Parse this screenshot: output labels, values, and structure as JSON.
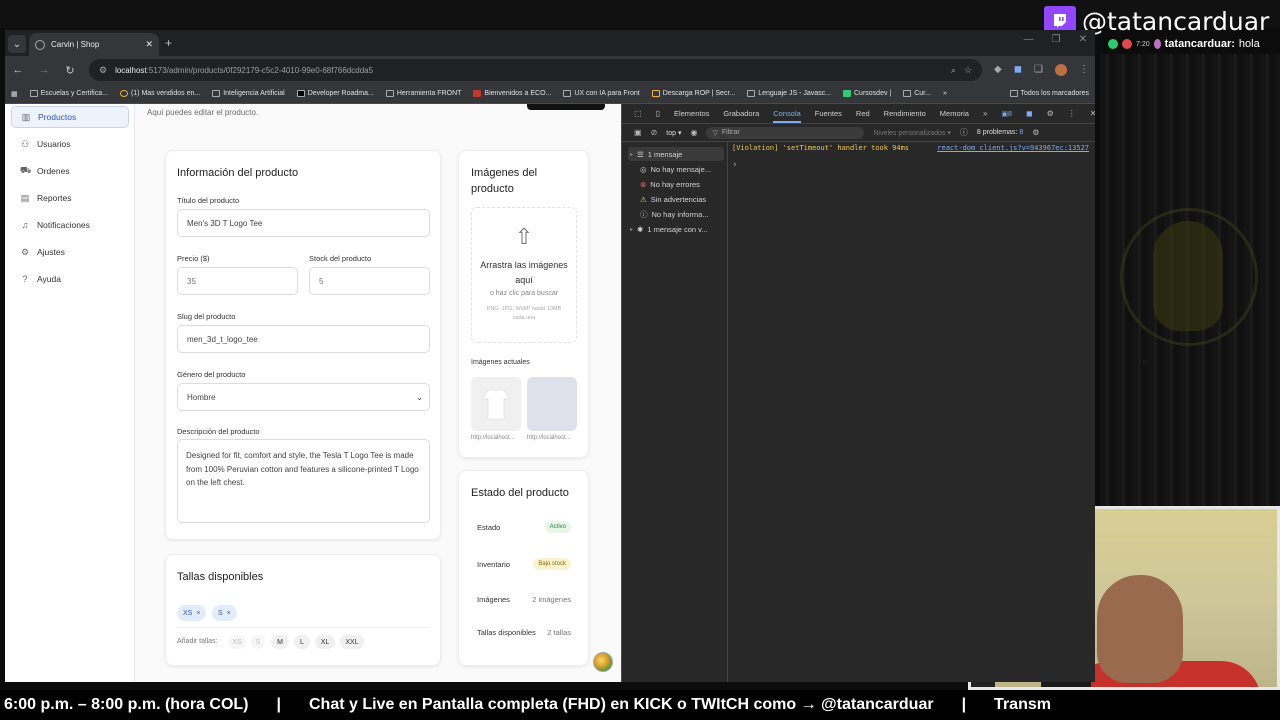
{
  "stream": {
    "twitch_handle": "@tatancarduar",
    "chat_user": "tatancarduar:",
    "chat_msg": "hola",
    "chat_time": "7:20",
    "ticker": [
      "6:00 p.m. – 8:00 p.m. (hora COL)",
      "|",
      "Chat y Live en Pantalla completa (FHD)  en KICK  o TWItCH como → @tatancarduar",
      "|",
      "Transm"
    ]
  },
  "browser": {
    "tab_title": "Carvin | Shop",
    "url_host": "localhost",
    "url_path": ":5173/admin/products/0f292179-c5c2-4010-99e0-68f766dcdda5",
    "bookmarks": [
      "Escuelas y Certifica...",
      "(1) Mas vendidos en...",
      "Inteligencia Artificial",
      "Developer Roadma...",
      "Herramienta FRONT",
      "Bienvenidos a ECO...",
      "UX con IA para Front",
      "Descarga ROP | Secr...",
      "Lenguaje JS - Javasc...",
      "Cursosdev |",
      "Cur..."
    ],
    "bookmarks_all": "Todos los marcadores"
  },
  "sidebar": {
    "items": [
      {
        "label": "Productos",
        "icon": "chart-icon"
      },
      {
        "label": "Usuarios",
        "icon": "users-icon"
      },
      {
        "label": "Ordenes",
        "icon": "cart-icon"
      },
      {
        "label": "Reportes",
        "icon": "document-icon"
      },
      {
        "label": "Notificaciones",
        "icon": "bell-icon"
      },
      {
        "label": "Ajustes",
        "icon": "gear-icon"
      },
      {
        "label": "Ayuda",
        "icon": "help-icon"
      }
    ]
  },
  "page": {
    "subtitle": "Aquí puedes editar el producto."
  },
  "product_info": {
    "title": "Información del producto",
    "title_label": "Título del producto",
    "title_value": "Men's 3D T Logo Tee",
    "price_label": "Precio ($)",
    "price_value": "35",
    "stock_label": "Stock del producto",
    "stock_value": "5",
    "slug_label": "Slug del producto",
    "slug_value": "men_3d_t_logo_tee",
    "gender_label": "Género del producto",
    "gender_value": "Hombre",
    "desc_label": "Descripción del producto",
    "desc_value": "Designed for fit, comfort and style, the Tesla T Logo Tee is made from 100% Peruvian cotton and features a silicone-printed T Logo on the left chest."
  },
  "images": {
    "title": "Imágenes del producto",
    "drop_main": "Arrastra las imágenes aquí",
    "drop_sub": "o haz clic para buscar",
    "drop_hint": "PNG, JPG, WebP hasta 10MB cada una",
    "current_label": "Imágenes actuales",
    "thumbs": [
      "http://localhost...",
      "http://localhost..."
    ]
  },
  "status": {
    "title": "Estado del producto",
    "rows": [
      {
        "label": "Estado",
        "value": "Activo"
      },
      {
        "label": "Inventario",
        "value": "Bajo stock"
      },
      {
        "label": "Imágenes",
        "value": "2 imágenes"
      },
      {
        "label": "Tallas disponibles",
        "value": "2 tallas"
      }
    ]
  },
  "sizes": {
    "title": "Tallas disponibles",
    "selected": [
      "XS",
      "S"
    ],
    "add_label": "Añadir tallas:",
    "options": [
      "XS",
      "S",
      "M",
      "L",
      "XL",
      "XXL"
    ]
  },
  "devtools": {
    "tabs": [
      "Elementos",
      "Grabadora",
      "Consola",
      "Fuentes",
      "Red",
      "Rendimiento",
      "Memoria"
    ],
    "tab_badge": "8",
    "context": "top",
    "filter_placeholder": "Filtrar",
    "levels": "Niveles personalizados",
    "problems": "8 problemas:",
    "problems_count": "8",
    "side_items": [
      "1 mensaje",
      "No hay mensaje...",
      "No hay errores",
      "Sin advertencias",
      "No hay informa...",
      "1 mensaje con v..."
    ],
    "violation": "[Violation] 'setTimeout' handler took 94ms",
    "violation_link": "react-dom_client.js?v=943967ec:13527"
  },
  "colors": {
    "accent": "#2b57c5",
    "twitch": "#9146ff",
    "devtools_active": "#7cacf8",
    "violation": "#f2c94c"
  }
}
